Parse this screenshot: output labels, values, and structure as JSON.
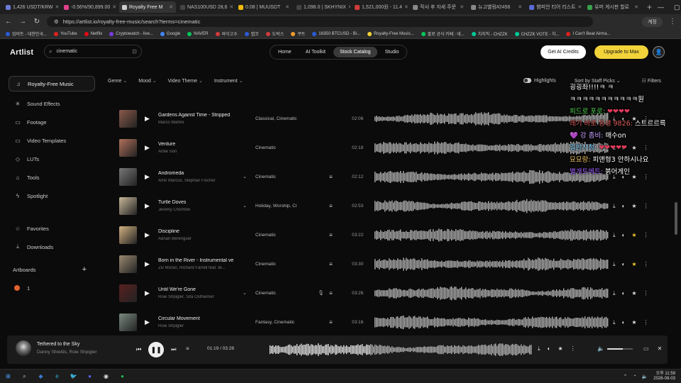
{
  "browser": {
    "tabs": [
      {
        "label": "1,426 USDT/KRW",
        "color": "#6b7bd6"
      },
      {
        "label": "-0.56%/90,899.00",
        "color": "#e0408a"
      },
      {
        "label": "Royalty Free M",
        "color": "#cccccc",
        "active": true
      },
      {
        "label": "NAS100USD 28,6",
        "color": "#444444"
      },
      {
        "label": "0.08 | MUUSDT",
        "color": "#f0b90b"
      },
      {
        "label": "1,096.0 | SKHYNIX",
        "color": "#444444"
      },
      {
        "label": "1,521,000원 - 11.4",
        "color": "#d23b3b"
      },
      {
        "label": "작사 후 자세 주문",
        "color": "#888888"
      },
      {
        "label": "뉴고별링#2456",
        "color": "#888888"
      },
      {
        "label": "챔피언 티어 리스트",
        "color": "#5a6ad6"
      },
      {
        "label": "유머 게시판 할로",
        "color": "#3aa04a"
      }
    ],
    "new_tab": "+",
    "url": "https://artlist.io/royalty-free-music/search?terms=cinematic",
    "profile": "계정",
    "bookmarks": [
      {
        "label": "업비트 - 대한민국...",
        "color": "#2a5bd7"
      },
      {
        "label": "YouTube",
        "color": "#e02020"
      },
      {
        "label": "Netflix",
        "color": "#e50914"
      },
      {
        "label": "Cryptowatch - live...",
        "color": "#7a3adf"
      },
      {
        "label": "Google",
        "color": "#4285f4"
      },
      {
        "label": "NAVER",
        "color": "#03c75a"
      },
      {
        "label": "와이고수",
        "color": "#d23b3b"
      },
      {
        "label": "랩코",
        "color": "#2a5bd7"
      },
      {
        "label": "도박스",
        "color": "#d23b3b"
      },
      {
        "label": "쿠트",
        "color": "#f29b2f"
      },
      {
        "label": "16350 BTCUSD - Bi...",
        "color": "#2a5bd7"
      },
      {
        "label": "Royalty-Free Music...",
        "color": "#f2d33a"
      },
      {
        "label": "팔로 공식 카페 : 네...",
        "color": "#03c75a"
      },
      {
        "label": "치지직 - CHZZK",
        "color": "#00c896"
      },
      {
        "label": "CHZZK VOTE - 치...",
        "color": "#00c896"
      },
      {
        "label": "I Can't Beat Airma...",
        "color": "#e02020"
      }
    ]
  },
  "app": {
    "logo": "Artlist",
    "search_value": "cinematic",
    "topnav": [
      "Home",
      "AI Toolkit",
      "Stock Catalog",
      "Studio"
    ],
    "topnav_active": "Stock Catalog",
    "credits_label": "Get AI Credits",
    "upgrade_label": "Upgrade to Max"
  },
  "sidebar": {
    "items": [
      {
        "label": "Royalty-Free Music",
        "icon": "♫",
        "active": true
      },
      {
        "label": "Sound Effects",
        "icon": "✳"
      },
      {
        "label": "Footage",
        "icon": "▭"
      },
      {
        "label": "Video Templates",
        "icon": "▭"
      },
      {
        "label": "LUTs",
        "icon": "◇"
      },
      {
        "label": "Tools",
        "icon": "⌂"
      },
      {
        "label": "Spotlight",
        "icon": "ϟ"
      }
    ],
    "secondary": [
      {
        "label": "Favorites",
        "icon": "☆"
      },
      {
        "label": "Downloads",
        "icon": "⤓"
      }
    ],
    "artboards_label": "Artboards",
    "artboard": "1"
  },
  "filters": {
    "left": [
      "Genre",
      "Mood",
      "Video Theme",
      "Instrument"
    ],
    "highlights": "Highlights",
    "sort": "Sort by Staff Picks",
    "filters_label": "Filters"
  },
  "tracks": [
    {
      "title": "Gardens Against Time - Stripped",
      "artist": "Marco Martini",
      "genre": "Classical, Cinematic",
      "duration": "02:06",
      "thumb": "#8a5a4a",
      "expand": false,
      "stems": false,
      "starred": false,
      "seed": 3
    },
    {
      "title": "Venture",
      "artist": "Ardie Son",
      "genre": "Cinematic",
      "duration": "02:18",
      "thumb": "#b0705a",
      "expand": false,
      "stems": false,
      "starred": false,
      "seed": 7
    },
    {
      "title": "Andromeda",
      "artist": "Amir Marcus, Stephan Fischer",
      "genre": "Cinematic",
      "duration": "02:12",
      "thumb": "#777777",
      "expand": true,
      "stems": true,
      "starred": false,
      "seed": 11
    },
    {
      "title": "Turtle Doves",
      "artist": "Jeremy Chontow",
      "genre": "Holiday, Worship, Ci",
      "duration": "02:53",
      "thumb": "#c8b89a",
      "expand": true,
      "stems": true,
      "starred": false,
      "seed": 5
    },
    {
      "title": "Discipline",
      "artist": "Adrian Berenguer",
      "genre": "Cinematic",
      "duration": "03:22",
      "thumb": "#d0b080",
      "expand": false,
      "stems": true,
      "starred": true,
      "seed": 13
    },
    {
      "title": "Born in the River - Instrumental ve",
      "artist": "Ziv Moran, Richard Farrell feat. Bi...",
      "genre": "Cinematic",
      "duration": "03:30",
      "thumb": "#9a8a70",
      "expand": false,
      "stems": true,
      "starred": true,
      "seed": 17
    },
    {
      "title": "Until We're Gone",
      "artist": "Roie Shpigler, Sita Ostheimer",
      "genre": "Cinematic",
      "duration": "03:26",
      "thumb": "#5a2020",
      "expand": true,
      "stems": true,
      "starred": false,
      "seed": 19,
      "mic": true
    },
    {
      "title": "Circular Movement",
      "artist": "Roie Shpigler",
      "genre": "Fantasy, Cinematic",
      "duration": "03:16",
      "thumb": "#7a8a80",
      "expand": false,
      "stems": true,
      "starred": false,
      "seed": 23
    }
  ],
  "chat": [
    {
      "text": "굉굉좌!!!!ㅋ ㅋ",
      "color": "#ffffff"
    },
    {
      "text": "ㅋㅋㅋㅋㅋㅋㅋㅋㅋㅋㅋ원",
      "color": "#ffffff"
    },
    {
      "name": "피드로 포로:",
      "name_color": "#55dd55",
      "text": " ❤❤❤❤",
      "color": "#e03a5a"
    },
    {
      "name": "레기 바로 등생 9826:",
      "name_color": "#e05a5a",
      "text": " 스트르르륵",
      "color": "#ffffff"
    },
    {
      "name": "💜 강 좀비:",
      "name_color": "#c8a0ff",
      "text": " 매수on",
      "color": "#ffffff"
    },
    {
      "name": "일반시청:",
      "name_color": "#7ad0ff",
      "text": " ❤❤❤❤❤",
      "color": "#e03a5a"
    },
    {
      "name": "묘묘랑:",
      "name_color": "#f0c060",
      "text": " 피앤형3 안하시나요",
      "color": "#ffffff"
    },
    {
      "name": "별개트메트:",
      "name_color": "#a060ff",
      "text": " 붉어게인",
      "color": "#ffffff"
    }
  ],
  "player": {
    "title": "Tethered to the Sky",
    "artist": "Danny Shields, Roie Shpigler",
    "time": "01:19 / 03:28",
    "progress": 0.38,
    "volume": 0.6
  },
  "taskbar": {
    "apps": [
      {
        "icon": "⊞",
        "color": "#4aa0ff"
      },
      {
        "icon": "⌕",
        "color": "#cccccc"
      },
      {
        "icon": "◆",
        "color": "#3a7ad0"
      },
      {
        "icon": "e",
        "color": "#2ab0d0"
      },
      {
        "icon": "🐦",
        "color": "#1d9bf0"
      },
      {
        "icon": "●",
        "color": "#5865f2"
      },
      {
        "icon": "◉",
        "color": "#e0e0e0"
      },
      {
        "icon": "●",
        "color": "#1db954"
      }
    ],
    "time": "오후 11:59",
    "date": "2026-08-03"
  },
  "icons": {
    "search": "⌕",
    "play": "▶",
    "pause": "❚❚",
    "prev": "⏮",
    "next": "⏭",
    "expand": "⌄",
    "stems": "≡",
    "mic": "🎙",
    "download": "⤓",
    "add": "◐",
    "star": "★",
    "more": "⋮",
    "volume": "🔈",
    "close": "✕",
    "screen": "▭",
    "plus": "+",
    "filters": "☷",
    "avatar": "👤"
  },
  "colors": {
    "accent_yellow": "#f2d33a",
    "star_active": "#f2c62f",
    "artboard_dot": "#e2622f"
  }
}
